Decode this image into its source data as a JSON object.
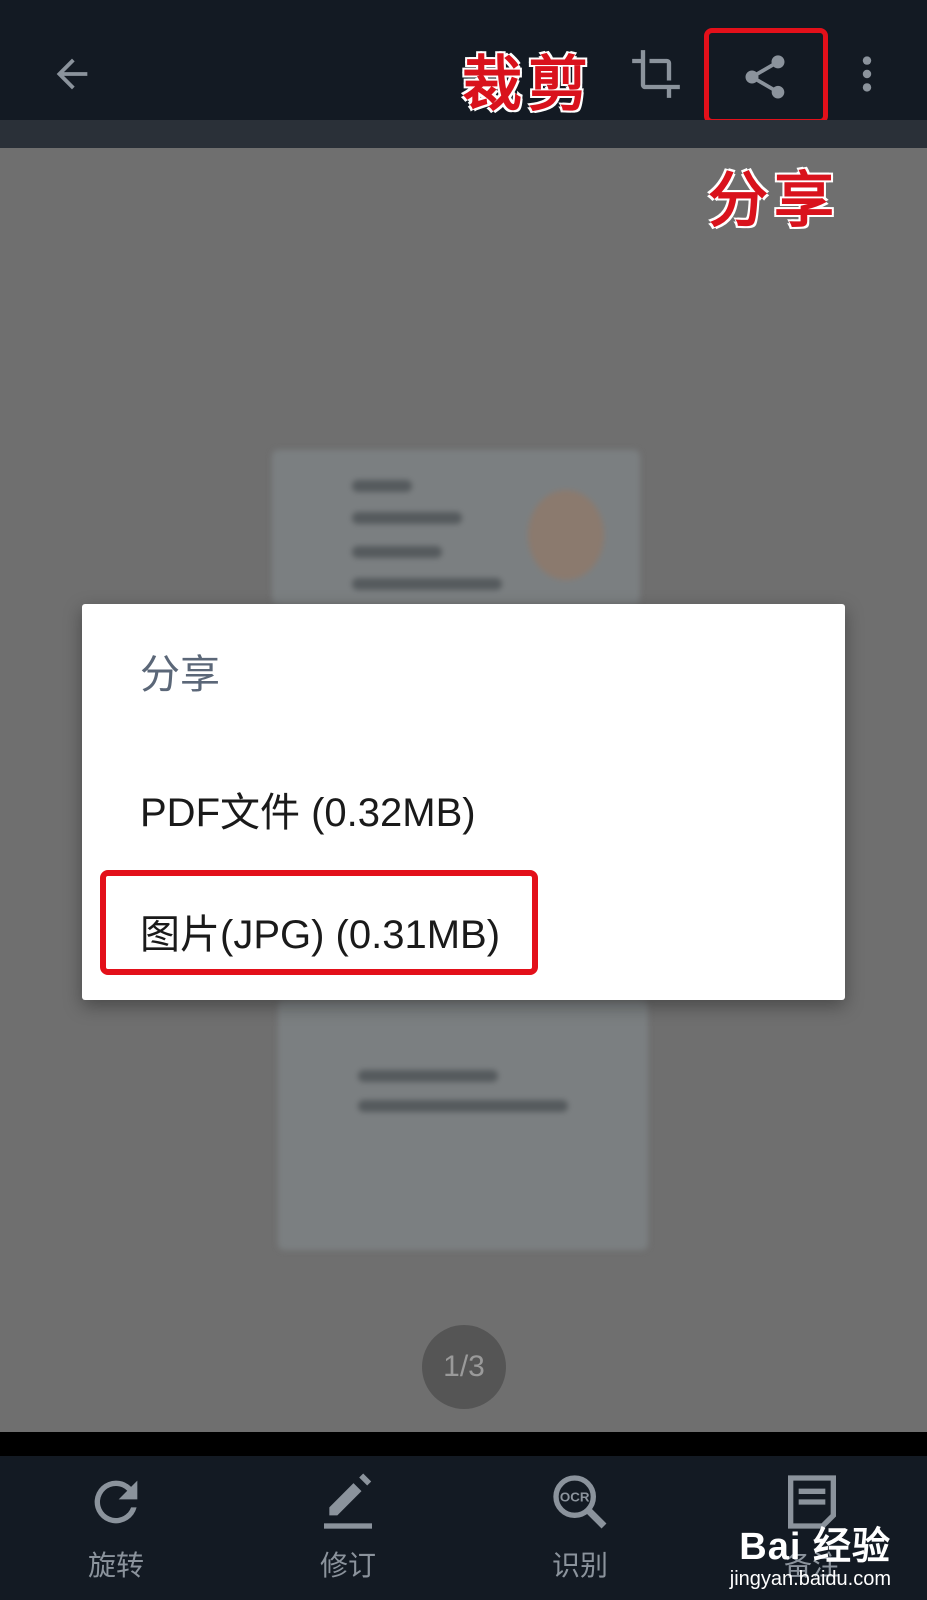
{
  "toolbar": {
    "annotation_crop": "裁剪",
    "annotation_share": "分享",
    "icons": [
      "back-arrow-icon",
      "crop-icon",
      "share-icon",
      "more-vert-icon"
    ]
  },
  "dialog": {
    "title": "分享",
    "options": [
      {
        "label": "PDF文件 (0.32MB)"
      },
      {
        "label": "图片(JPG) (0.31MB)"
      }
    ]
  },
  "page_indicator": "1/3",
  "bottom_tools": [
    {
      "label": "旋转",
      "icon": "rotate-icon"
    },
    {
      "label": "修订",
      "icon": "edit-icon"
    },
    {
      "label": "识别",
      "icon": "ocr-search-icon"
    },
    {
      "label": "备注",
      "icon": "note-icon"
    }
  ],
  "watermark": {
    "brand": "Bai 经验",
    "url": "jingyan.baidu.com"
  },
  "colors": {
    "highlight": "#e3101a",
    "topbar": "#131a23",
    "overlay": "#6f6f6f",
    "dialog_title": "#5b6778"
  }
}
